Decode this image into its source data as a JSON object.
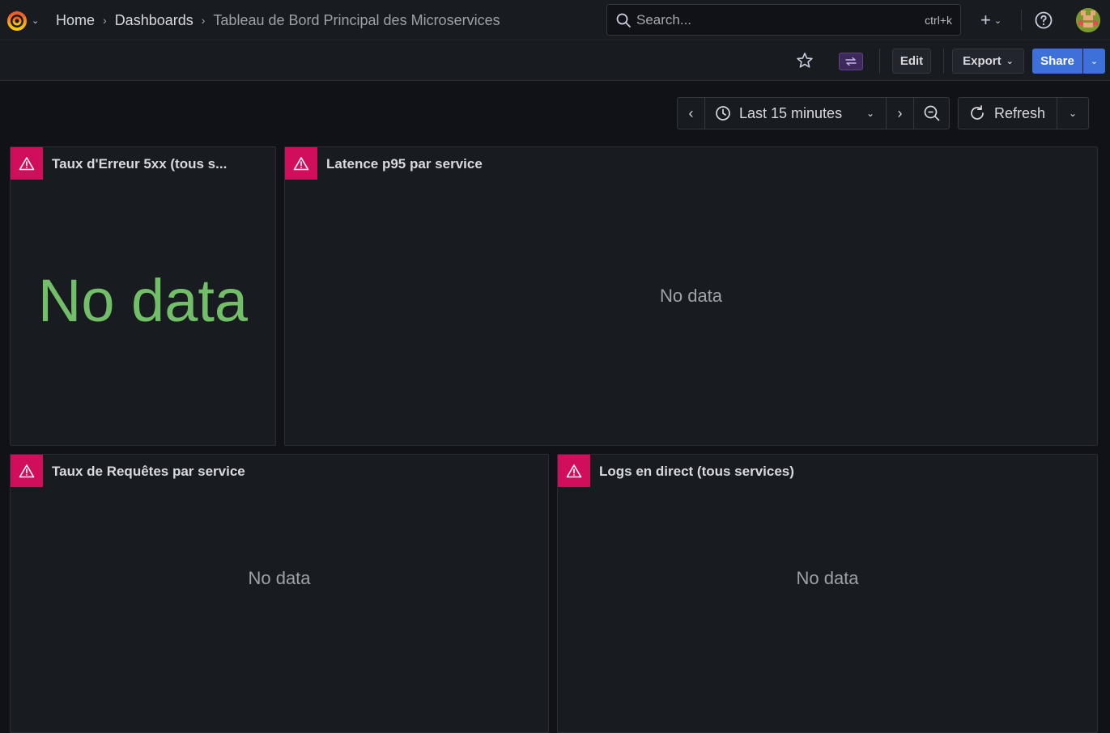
{
  "header": {
    "breadcrumbs": [
      {
        "label": "Home"
      },
      {
        "label": "Dashboards"
      },
      {
        "label": "Tableau de Bord Principal des Microservices"
      }
    ],
    "search": {
      "placeholder": "Search...",
      "shortcut": "ctrl+k"
    },
    "icons": {
      "logo": "grafana-logo-icon",
      "add": "plus-icon",
      "help": "help-circle-icon",
      "avatar": "user-avatar"
    }
  },
  "toolbar": {
    "edit_label": "Edit",
    "export_label": "Export",
    "share_label": "Share",
    "icons": {
      "star": "star-icon",
      "swap": "swap-icon"
    }
  },
  "time_controls": {
    "range_label": "Last 15 minutes",
    "refresh_label": "Refresh"
  },
  "panels": [
    {
      "title": "Taux d'Erreur 5xx (tous s...",
      "status": "No data"
    },
    {
      "title": "Latence p95 par service",
      "status": "No data"
    },
    {
      "title": "Taux de Requêtes par service",
      "status": "No data"
    },
    {
      "title": "Logs en direct (tous services)",
      "status": "No data"
    }
  ],
  "colors": {
    "background": "#111217",
    "panel": "#181b1f",
    "error_badge": "#d10e5c",
    "primary": "#3d71d9",
    "nodata_green": "#73bf69"
  }
}
